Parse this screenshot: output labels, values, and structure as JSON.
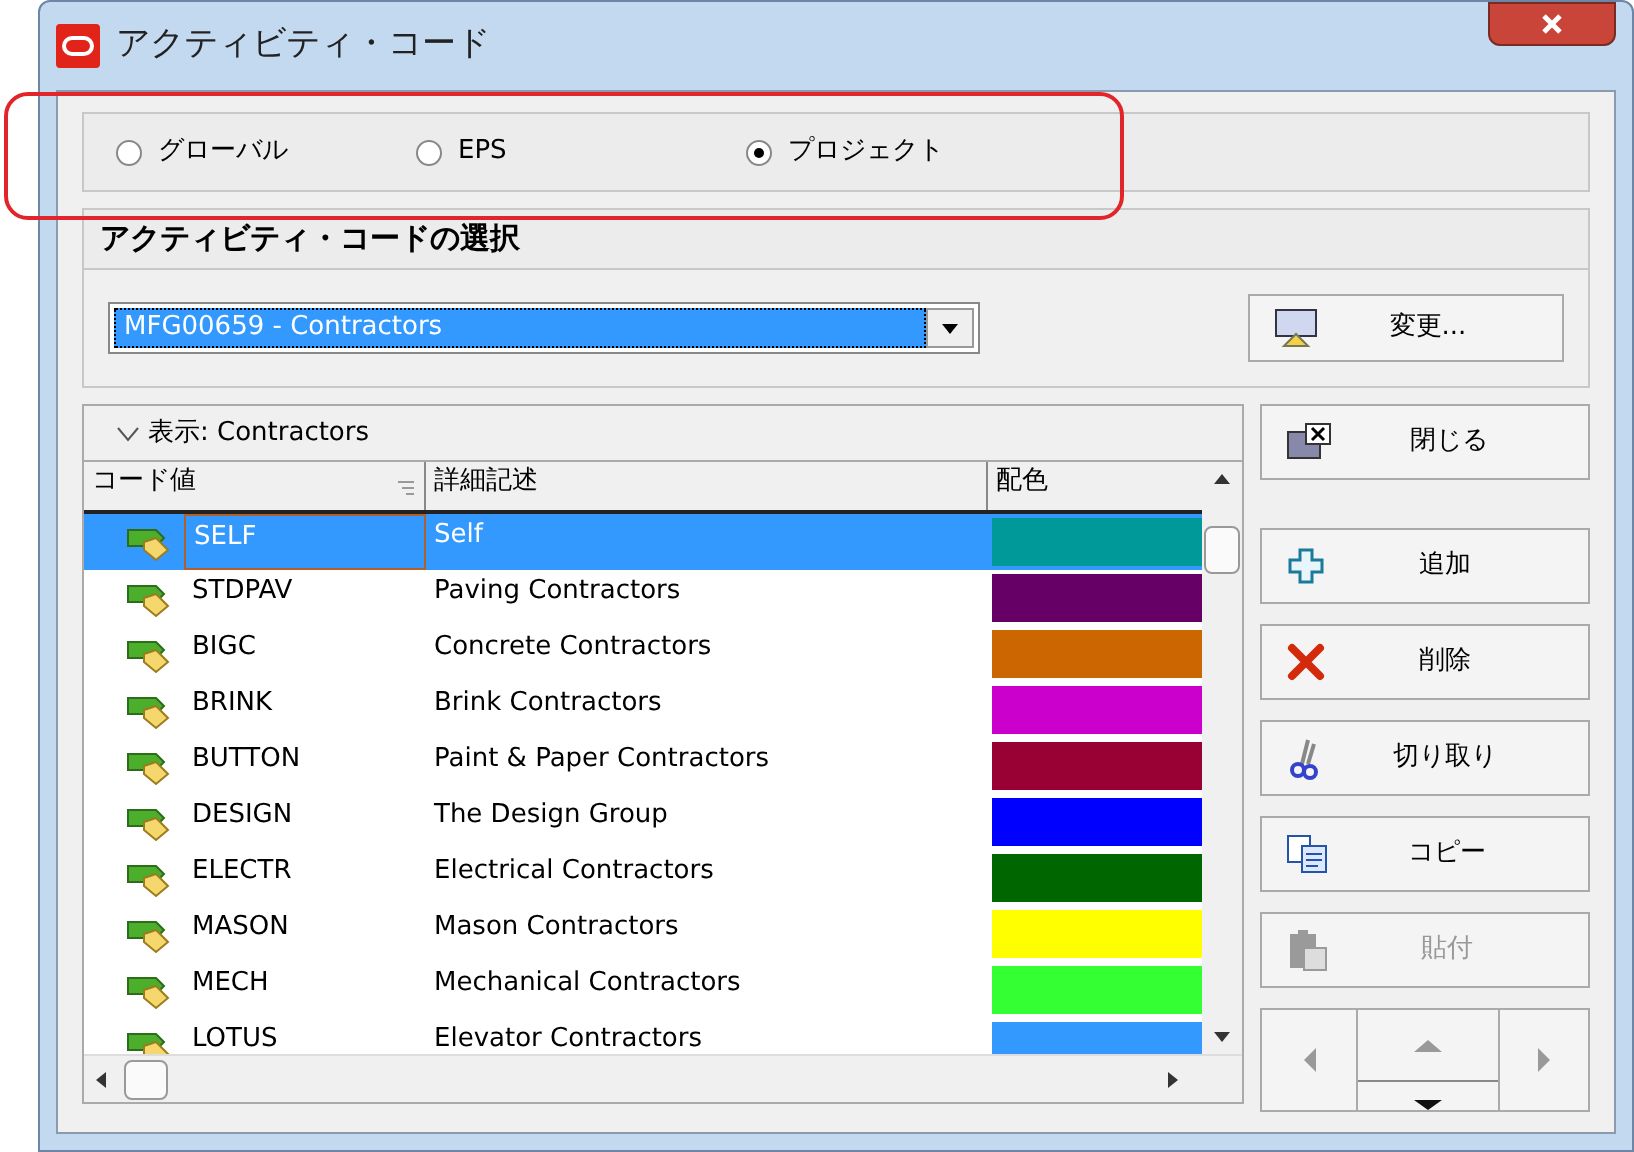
{
  "window": {
    "title": "アクティビティ・コード"
  },
  "scope_options": [
    {
      "label": "グローバル",
      "selected": false
    },
    {
      "label": "EPS",
      "selected": false
    },
    {
      "label": "プロジェクト",
      "selected": true
    }
  ],
  "section_title": "アクティビティ・コードの選択",
  "code_type_dropdown": {
    "value": "MFG00659 - Contractors"
  },
  "change_button": "変更...",
  "table": {
    "filter_label": "表示: Contractors",
    "columns": [
      "コード値",
      "詳細記述",
      "配色"
    ],
    "rows": [
      {
        "code": "SELF",
        "description": "Self",
        "color": "#009999",
        "selected": true
      },
      {
        "code": "STDPAV",
        "description": "Paving Contractors",
        "color": "#660066",
        "selected": false
      },
      {
        "code": "BIGC",
        "description": "Concrete Contractors",
        "color": "#cc6600",
        "selected": false
      },
      {
        "code": "BRINK",
        "description": "Brink Contractors",
        "color": "#cc00cc",
        "selected": false
      },
      {
        "code": "BUTTON",
        "description": "Paint & Paper Contractors",
        "color": "#990033",
        "selected": false
      },
      {
        "code": "DESIGN",
        "description": "The Design Group",
        "color": "#0000ff",
        "selected": false
      },
      {
        "code": "ELECTR",
        "description": "Electrical Contractors",
        "color": "#006600",
        "selected": false
      },
      {
        "code": "MASON",
        "description": "Mason Contractors",
        "color": "#ffff00",
        "selected": false
      },
      {
        "code": "MECH",
        "description": "Mechanical Contractors",
        "color": "#33ff33",
        "selected": false
      },
      {
        "code": "LOTUS",
        "description": "Elevator Contractors",
        "color": "#3399ff",
        "selected": false
      }
    ]
  },
  "buttons": [
    {
      "label": "閉じる",
      "disabled": false
    },
    {
      "label": "追加",
      "disabled": false
    },
    {
      "label": "削除",
      "disabled": false
    },
    {
      "label": "切り取り",
      "disabled": false
    },
    {
      "label": "コピー",
      "disabled": false
    },
    {
      "label": "貼付",
      "disabled": true
    }
  ]
}
